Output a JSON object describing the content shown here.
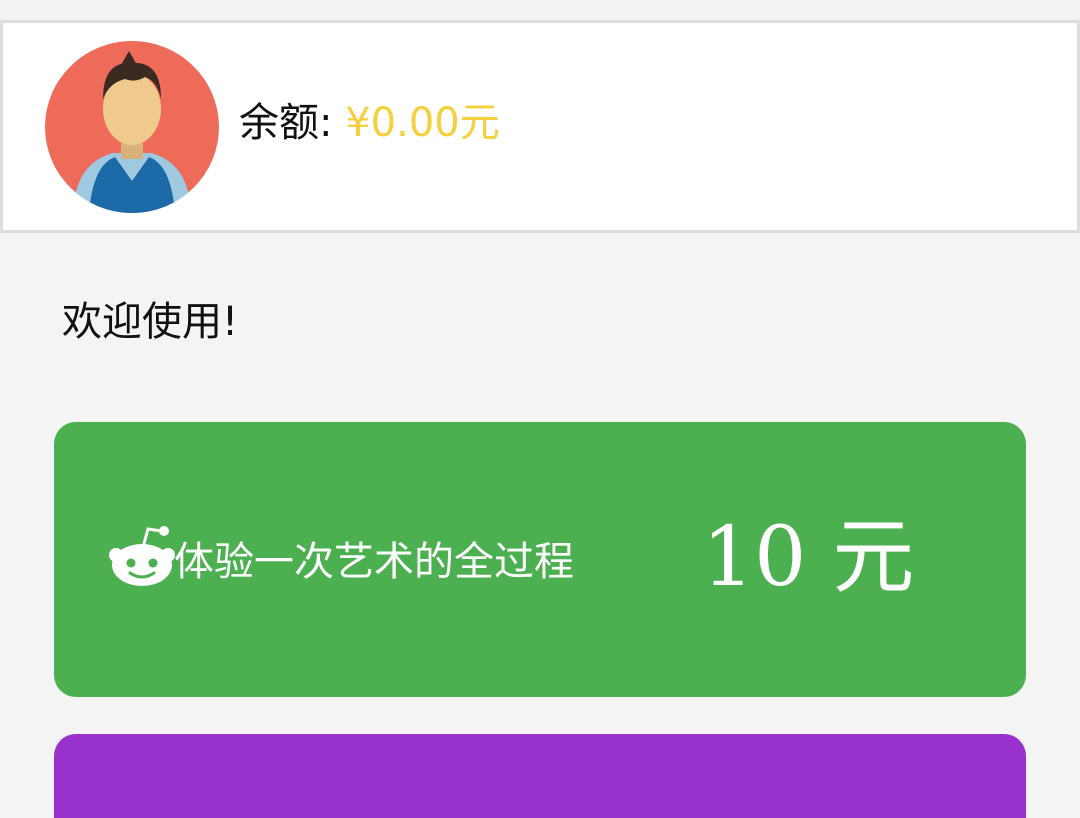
{
  "profile": {
    "balance_label": "余额:",
    "balance_amount": "¥0.00元",
    "avatar_icon": "user-avatar-icon"
  },
  "welcome_text": "欢迎使用!",
  "plans": [
    {
      "icon": "reddit-alien-icon",
      "description": "体验一次艺术的全过程",
      "price": "10 元",
      "color": "#4caf50"
    },
    {
      "color": "#9932cc"
    }
  ],
  "colors": {
    "background": "#f4f4f4",
    "amount": "#f4d03f",
    "avatar_bg": "#ee6b5a"
  }
}
